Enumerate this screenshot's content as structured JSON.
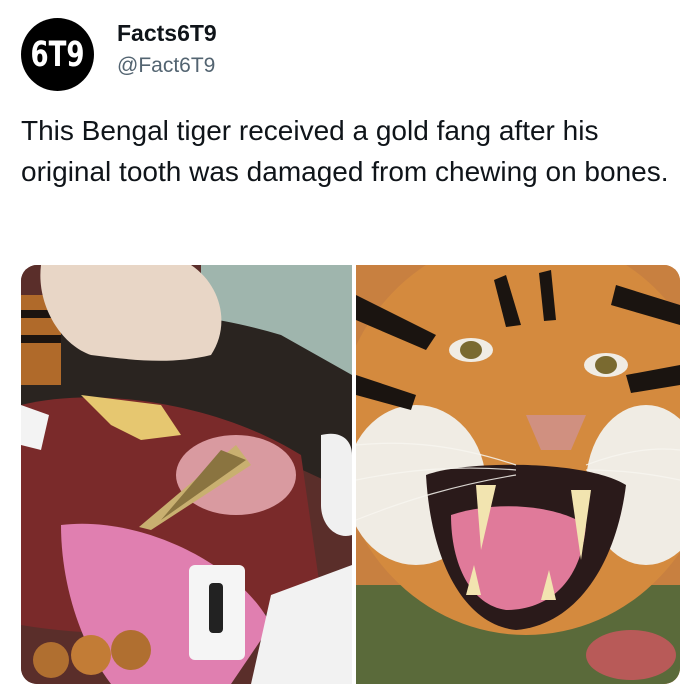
{
  "tweet": {
    "author": {
      "avatar_text": "6T9",
      "display_name": "Facts6T9",
      "handle": "@Fact6T9"
    },
    "text": "This Bengal tiger received a gold fang after his original tooth was damaged from chewing on bones.",
    "media": [
      {
        "type": "photo",
        "subject": "vet-procedure-gold-fang"
      },
      {
        "type": "photo",
        "subject": "snarling-bengal-tiger"
      }
    ]
  },
  "colors": {
    "text_primary": "#0f1419",
    "text_secondary": "#536471",
    "avatar_bg": "#000000"
  }
}
